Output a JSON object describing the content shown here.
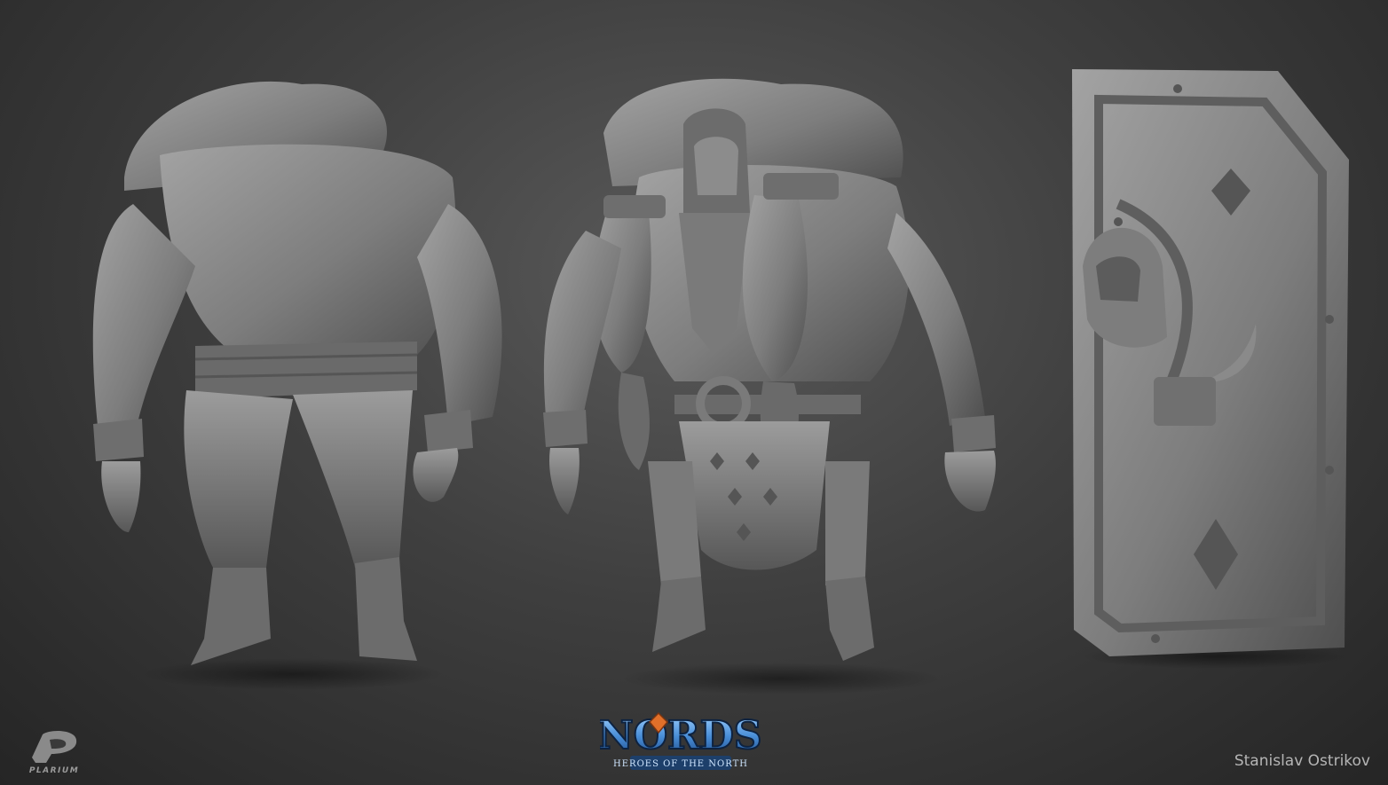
{
  "logos": {
    "publisher": "PLARIUM",
    "game_title": "NORDS",
    "game_subtitle": "HEROES OF THE NORTH"
  },
  "credit": {
    "artist": "Stanislav Ostrikov"
  },
  "colors": {
    "background": "#3a3a3a",
    "clay": "#8a8a8a",
    "clay_dark": "#5c5c5c",
    "nords_blue": "#4a8fd8",
    "nords_orange": "#e0702a"
  }
}
